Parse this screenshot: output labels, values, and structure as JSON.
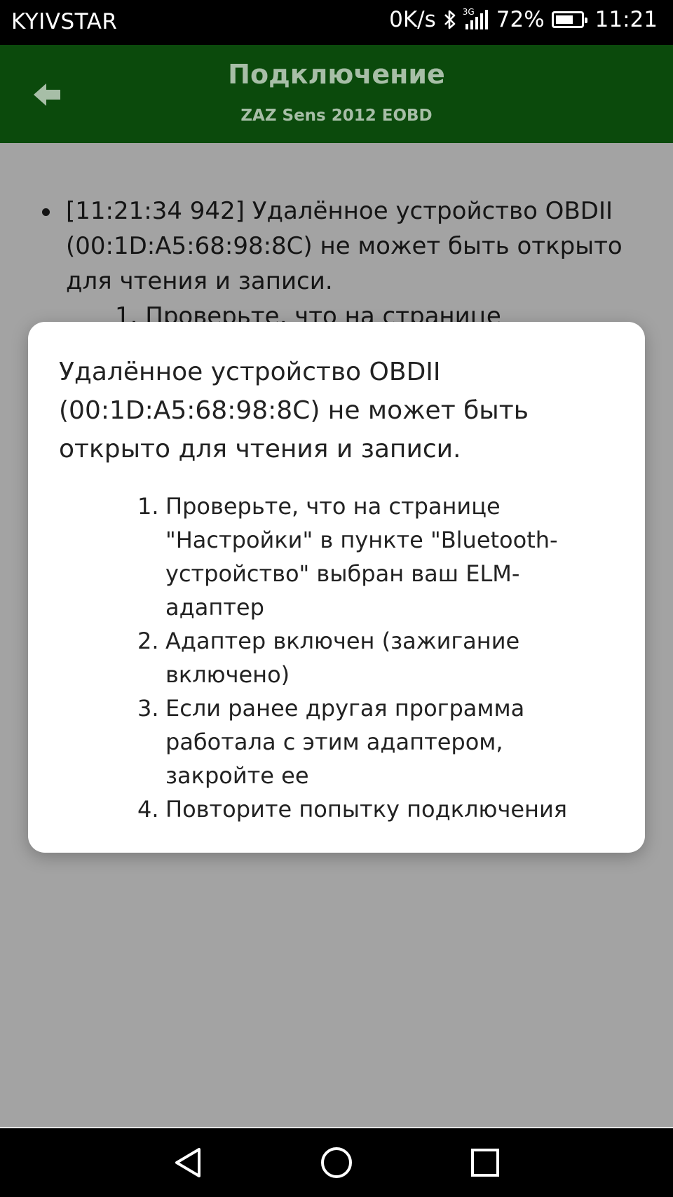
{
  "status_bar": {
    "carrier": "KYIVSTAR",
    "speed": "0K/s",
    "network_label": "3G",
    "battery": "72%",
    "battery_level": 0.72,
    "time": "11:21"
  },
  "app_bar": {
    "title": "Подключение",
    "subtitle": "ZAZ Sens 2012 EOBD",
    "back_icon": "arrow-left-icon"
  },
  "log": {
    "entry_text": "[11:21:34 942] Удалённое устройство OBDII (00:1D:A5:68:98:8C) не может быть открыто для чтения и записи.",
    "partial_step": "1. Проверьте, что на странице"
  },
  "dialog": {
    "message": "Удалённое устройство OBDII (00:1D:A5:68:98:8C) не может быть открыто для чтения и записи.",
    "steps": [
      {
        "num": "1.",
        "text": "Проверьте, что на странице \"Настройки\" в пункте \"Bluetooth-устройство\" выбран ваш ELM-адаптер"
      },
      {
        "num": "2.",
        "text": "Адаптер включен (зажигание включено)"
      },
      {
        "num": "3.",
        "text": "Если ранее другая программа работала с этим адаптером, закройте ее"
      },
      {
        "num": "4.",
        "text": "Повторите попытку подключения"
      }
    ]
  },
  "colors": {
    "app_bar": "#0b4a0c",
    "scrim_background": "#a3a3a3",
    "dialog": "#ffffff"
  }
}
